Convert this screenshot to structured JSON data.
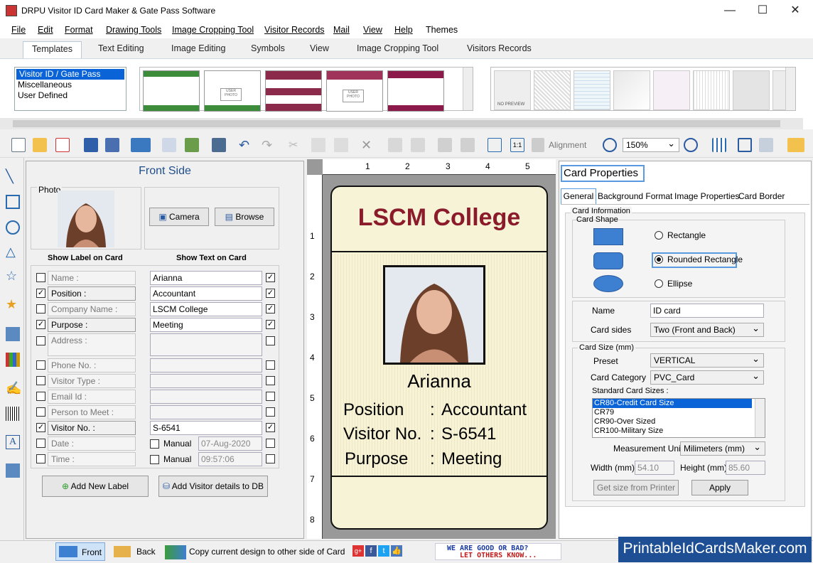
{
  "window": {
    "title": "DRPU Visitor ID Card Maker & Gate Pass Software",
    "min": "—",
    "max": "☐",
    "close": "✕"
  },
  "menu": [
    "File",
    "Edit",
    "Format",
    "Drawing Tools",
    "Image Cropping Tool",
    "Visitor Records",
    "Mail",
    "View",
    "Help",
    "Themes"
  ],
  "ribbon_tabs": [
    "Templates",
    "Text Editing",
    "Image Editing",
    "Symbols",
    "View",
    "Image Cropping Tool",
    "Visitors Records"
  ],
  "template_categories": [
    "Visitor ID / Gate Pass",
    "Miscellaneous",
    "User Defined"
  ],
  "thumb_texts": {
    "user_photo": "USER PHOTO",
    "no_preview": "NO PREVIEW"
  },
  "toolbar": {
    "alignment": "Alignment",
    "zoom": "150%"
  },
  "front": {
    "title": "Front Side",
    "photo_label": "Photo",
    "camera": "Camera",
    "browse": "Browse",
    "show_label": "Show Label on Card",
    "show_text": "Show Text on Card",
    "rows": [
      {
        "label": "Name :",
        "on": false,
        "value": "Arianna",
        "show": true
      },
      {
        "label": "Position      :",
        "on": true,
        "value": "Accountant",
        "show": true
      },
      {
        "label": "Company Name :",
        "on": false,
        "value": "LSCM College",
        "show": true
      },
      {
        "label": "Purpose      :",
        "on": true,
        "value": "Meeting",
        "show": true
      },
      {
        "label": "Address :",
        "on": false,
        "value": "",
        "show": false
      },
      {
        "label": "Phone No. :",
        "on": false,
        "value": "",
        "show": false
      },
      {
        "label": "Visitor Type :",
        "on": false,
        "value": "",
        "show": false
      },
      {
        "label": "Email Id :",
        "on": false,
        "value": "",
        "show": false
      },
      {
        "label": "Person to Meet :",
        "on": false,
        "value": "",
        "show": false
      },
      {
        "label": "Visitor No.     :",
        "on": true,
        "value": "S-6541",
        "show": true
      },
      {
        "label": "Date :",
        "on": false,
        "value": "07-Aug-2020",
        "show": false
      },
      {
        "label": "Time :",
        "on": false,
        "value": "09:57:06",
        "show": false
      }
    ],
    "manual": "Manual",
    "add_label": "Add New Label",
    "add_db": "Add Visitor details to DB"
  },
  "card": {
    "college": "LSCM College",
    "name": "Arianna",
    "lines": [
      {
        "k": "Position",
        "v": "Accountant"
      },
      {
        "k": "Visitor No.",
        "v": "S-6541"
      },
      {
        "k": "Purpose",
        "v": "Meeting"
      }
    ],
    "ruler_top": [
      "1",
      "2",
      "3",
      "4",
      "5"
    ],
    "ruler_left": [
      "1",
      "2",
      "3",
      "4",
      "5",
      "6",
      "7",
      "8"
    ]
  },
  "props": {
    "title": "Card Properties",
    "tabs": [
      "General",
      "Background Format",
      "Image Properties",
      "Card Border"
    ],
    "card_info": "Card Information",
    "card_shape": "Card Shape",
    "shapes": [
      "Rectangle",
      "Rounded Rectangle",
      "Ellipse"
    ],
    "name_label": "Name",
    "name_value": "ID card",
    "sides_label": "Card sides",
    "sides_value": "Two (Front and Back)",
    "size_group": "Card Size (mm)",
    "preset_label": "Preset",
    "preset_value": "VERTICAL",
    "category_label": "Card Category",
    "category_value": "PVC_Card",
    "std_label": "Standard Card Sizes :",
    "std_sizes": [
      "CR80-Credit Card Size",
      "CR79",
      "CR90-Over Sized",
      "CR100-Military Size"
    ],
    "unit_label": "Measurement Unit :",
    "unit_value": "Milimeters (mm)",
    "width_label": "Width  (mm)",
    "width_value": "54.10",
    "height_label": "Height   (mm)",
    "height_value": "85.60",
    "get_size": "Get size from Printer",
    "apply": "Apply"
  },
  "status": {
    "front": "Front",
    "back": "Back",
    "copy": "Copy current design to other side of Card",
    "banner1": "WE ARE GOOD OR BAD?",
    "banner2": "LET OTHERS KNOW...",
    "brand": "PrintableIdCardsMaker.com"
  }
}
